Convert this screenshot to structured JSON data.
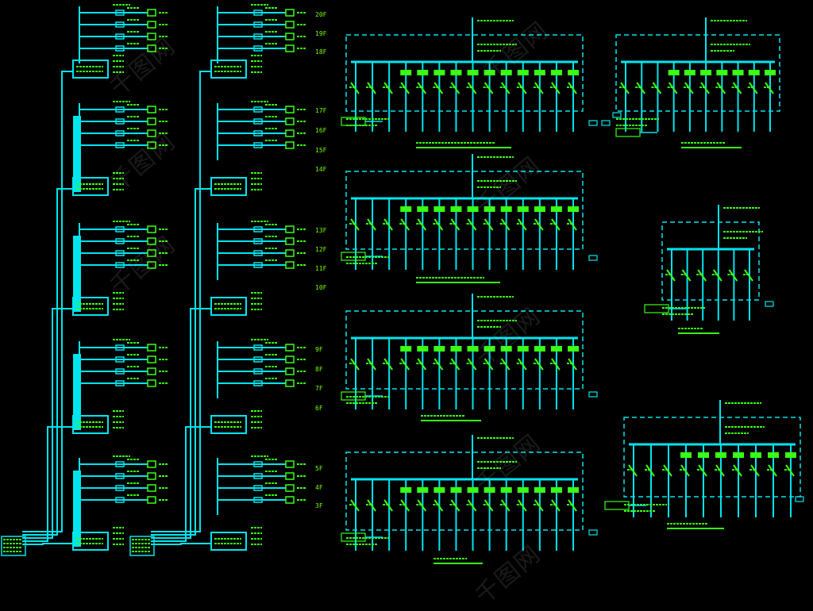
{
  "drawing": {
    "colors": {
      "background": "#000000",
      "bus": "#00e5ee",
      "text": "#39ff14",
      "dash": "#00e5ee"
    },
    "riser_floor_labels_left": [
      "20F",
      "19F",
      "18F",
      "17F",
      "16F",
      "15F",
      "14F",
      "13F",
      "12F",
      "11F",
      "10F",
      "9F",
      "8F",
      "7F",
      "6F",
      "5F",
      "4F",
      "3F"
    ],
    "watermark": "千图网"
  }
}
